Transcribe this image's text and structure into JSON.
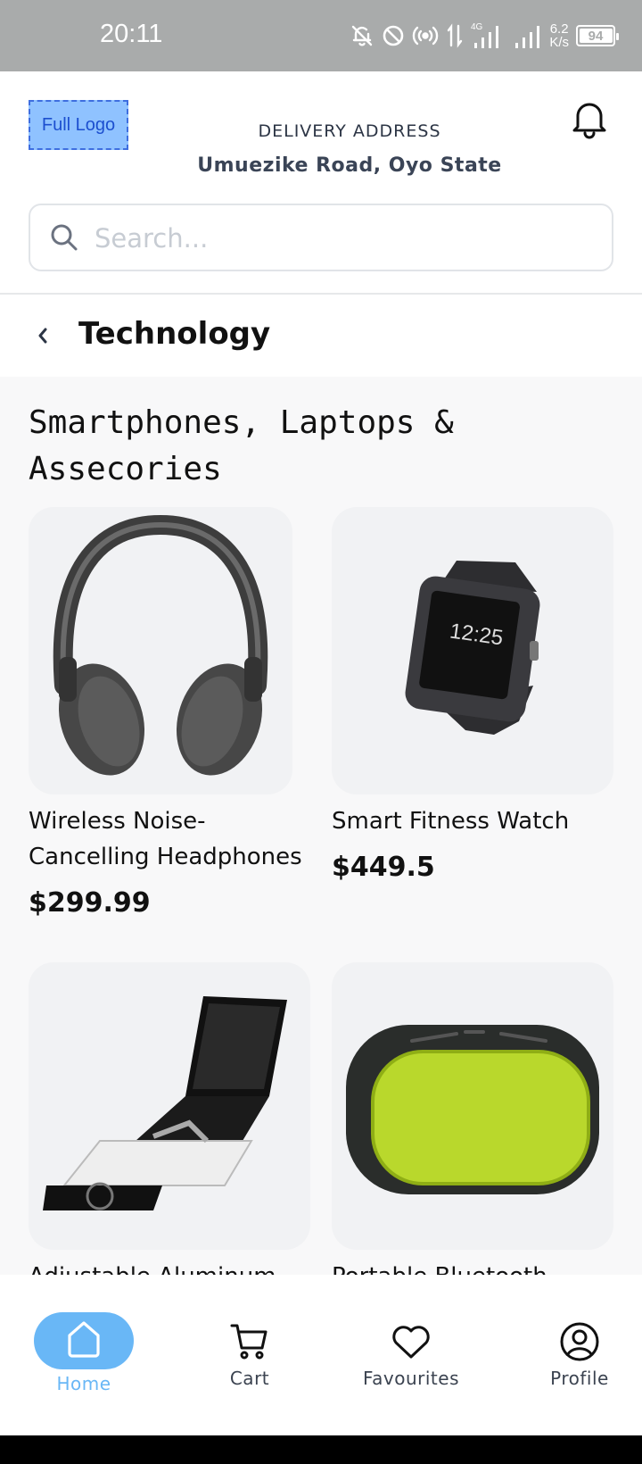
{
  "status_bar": {
    "time": "20:11",
    "network": "4G",
    "speed_value": "6.2",
    "speed_unit": "K/s",
    "battery": "94",
    "icons": [
      "bell-off-icon",
      "do-not-disturb-icon",
      "hotspot-icon",
      "data-arrows-icon",
      "signal-icon",
      "signal-icon-2"
    ]
  },
  "header": {
    "logo_text": "Full Logo",
    "delivery_label": "DELIVERY ADDRESS",
    "delivery_address": "Umuezike Road, Oyo State",
    "notification_icon": "bell-icon"
  },
  "search": {
    "placeholder": "Search..."
  },
  "category": {
    "title": "Technology",
    "back_icon": "chevron-left-icon"
  },
  "section": {
    "title": "Smartphones, Laptops & Assecories"
  },
  "products": [
    {
      "name": "Wireless Noise-Cancelling Headphones",
      "price": "$299.99"
    },
    {
      "name": "Smart Fitness Watch",
      "price": "$449.5"
    },
    {
      "name": "Adjustable Aluminum"
    },
    {
      "name": "Portable Bluetooth"
    }
  ],
  "bottom_nav": {
    "items": [
      {
        "label": "Home",
        "icon": "home-icon",
        "active": true
      },
      {
        "label": "Cart",
        "icon": "cart-icon",
        "active": false
      },
      {
        "label": "Favourites",
        "icon": "heart-icon",
        "active": false
      },
      {
        "label": "Profile",
        "icon": "profile-icon",
        "active": false
      }
    ]
  },
  "colors": {
    "accent": "#69b7f6",
    "active_label": "#69b7f6",
    "status_bar": "#a9abab",
    "page_bg": "#f8f8f9",
    "card_bg": "#f1f2f4"
  }
}
